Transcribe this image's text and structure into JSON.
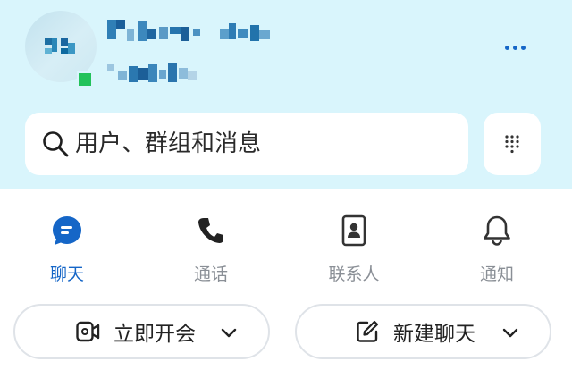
{
  "header": {
    "more_icon": "ellipsis-icon",
    "presence_color": "#22c25a"
  },
  "search": {
    "placeholder": "用户、群组和消息",
    "icon": "search-icon"
  },
  "dialpad": {
    "icon": "dialpad-icon"
  },
  "tabs": [
    {
      "label": "聊天",
      "icon": "chat-bubble-icon",
      "active": true
    },
    {
      "label": "通话",
      "icon": "phone-icon",
      "active": false
    },
    {
      "label": "联系人",
      "icon": "contacts-book-icon",
      "active": false
    },
    {
      "label": "通知",
      "icon": "bell-icon",
      "active": false
    }
  ],
  "actions": {
    "meet_now": "立即开会",
    "new_chat": "新建聊天"
  },
  "colors": {
    "accent": "#1566c7",
    "header_bg": "#d9f5fc",
    "inactive": "#8a8f96"
  }
}
